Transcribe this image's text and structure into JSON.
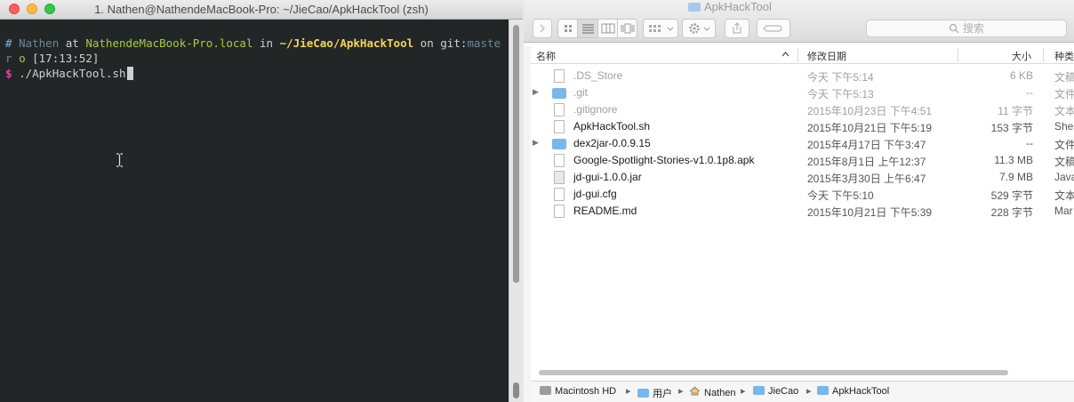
{
  "terminal": {
    "title": "1. Nathen@NathendeMacBook-Pro: ~/JieCao/ApkHackTool (zsh)",
    "line1": {
      "hash": "#",
      "user": "Nathen",
      "at": "at",
      "host": "NathendeMacBook-Pro.local",
      "in": "in",
      "path": "~/JieCao/ApkHackTool",
      "on": "on",
      "git": "git:",
      "branch": "master",
      "status": "o",
      "time": "[17:13:52]"
    },
    "line2": {
      "prompt": "$",
      "command": "./ApkHackTool.sh"
    }
  },
  "finder": {
    "title": "ApkHackTool",
    "search_placeholder": "搜索",
    "columns": {
      "name": "名称",
      "date": "修改日期",
      "size": "大小",
      "kind": "种类"
    },
    "files": [
      {
        "name": ".DS_Store",
        "date": "今天 下午5:14",
        "size": "6 KB",
        "kind": "文稿",
        "type": "file",
        "dim": true
      },
      {
        "name": ".git",
        "date": "今天 下午5:13",
        "size": "--",
        "kind": "文件",
        "type": "folder",
        "dim": true
      },
      {
        "name": ".gitignore",
        "date": "2015年10月23日 下午4:51",
        "size": "11 字节",
        "kind": "文本",
        "type": "file",
        "dim": true
      },
      {
        "name": "ApkHackTool.sh",
        "date": "2015年10月21日 下午5:19",
        "size": "153 字节",
        "kind": "Shel",
        "type": "file",
        "dim": false
      },
      {
        "name": "dex2jar-0.0.9.15",
        "date": "2015年4月17日 下午3:47",
        "size": "--",
        "kind": "文件",
        "type": "folder",
        "dim": false
      },
      {
        "name": "Google-Spotlight-Stories-v1.0.1p8.apk",
        "date": "2015年8月1日 上午12:37",
        "size": "11.3 MB",
        "kind": "文稿",
        "type": "file",
        "dim": false
      },
      {
        "name": "jd-gui-1.0.0.jar",
        "date": "2015年3月30日 上午6:47",
        "size": "7.9 MB",
        "kind": "Java",
        "type": "jar",
        "dim": false
      },
      {
        "name": "jd-gui.cfg",
        "date": "今天 下午5:10",
        "size": "529 字节",
        "kind": "文本",
        "type": "file",
        "dim": false
      },
      {
        "name": "README.md",
        "date": "2015年10月21日 下午5:39",
        "size": "228 字节",
        "kind": "Mar",
        "type": "file",
        "dim": false
      }
    ],
    "pathbar": [
      "Macintosh HD",
      "用户",
      "Nathen",
      "JieCao",
      "ApkHackTool"
    ],
    "colors": {
      "folder": "#79b7ea",
      "terminal_bg": "#232627"
    }
  }
}
